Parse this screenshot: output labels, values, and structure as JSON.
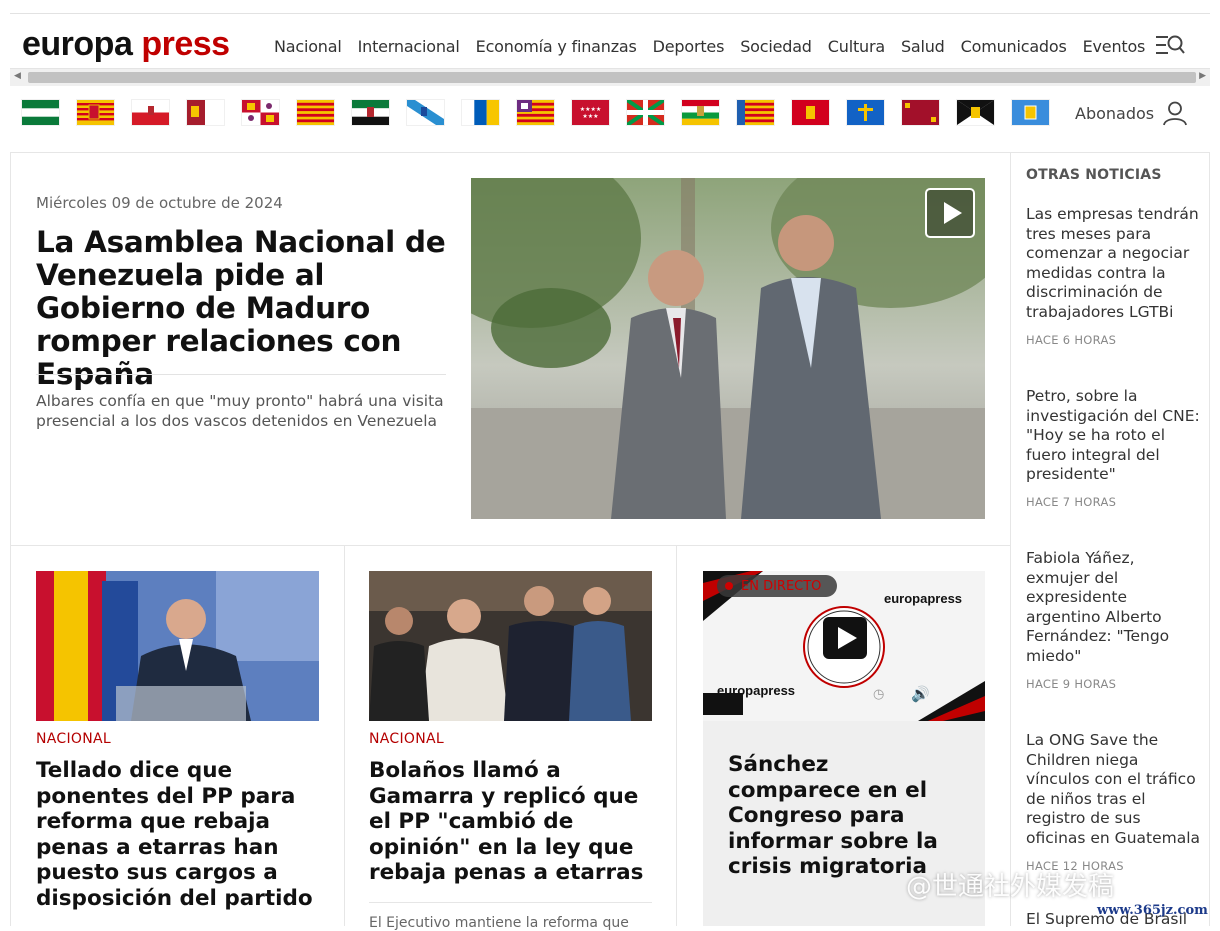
{
  "brand": {
    "part1": "europa",
    "part2": "press"
  },
  "nav": [
    "Nacional",
    "Internacional",
    "Economía y finanzas",
    "Deportes",
    "Sociedad",
    "Cultura",
    "Salud",
    "Comunicados",
    "Eventos"
  ],
  "account": {
    "label": "Abonados"
  },
  "lead_story": {
    "date": "Miércoles 09 de octubre de 2024",
    "title": "La Asamblea Nacional de Venezuela pide al Gobierno de Maduro romper relaciones con España",
    "summary": "Albares confía en que \"muy pronto\" habrá una visita presencial a los dos vascos detenidos en Venezuela"
  },
  "sidebar": {
    "title": "OTRAS NOTICIAS",
    "items": [
      {
        "text": "Las empresas tendrán tres meses para comenzar a negociar medidas contra la discriminación de trabajadores LGTBi",
        "time": "HACE 6 HORAS"
      },
      {
        "text": "Petro, sobre la investigación del CNE: \"Hoy se ha roto el fuero integral del presidente\"",
        "time": "HACE 7 HORAS"
      },
      {
        "text": "Fabiola Yáñez, exmujer del expresidente argentino Alberto Fernández: \"Tengo miedo\"",
        "time": "HACE 9 HORAS"
      },
      {
        "text": "La ONG Save the Children niega vínculos con el tráfico de niños tras el registro de sus oficinas en Guatemala",
        "time": "HACE 12 HORAS"
      },
      {
        "text": "El Supremo de Brasil",
        "time": ""
      }
    ]
  },
  "cards": [
    {
      "category": "NACIONAL",
      "title": "Tellado dice que ponentes del PP para reforma que rebaja penas a etarras han puesto sus cargos a disposición del partido"
    },
    {
      "category": "NACIONAL",
      "title": "Bolaños llamó a Gamarra y replicó que el PP \"cambió de opinión\" en la ley que rebaja penas a etarras",
      "summary": "El Ejecutivo mantiene la reforma que"
    },
    {
      "live_badge": "EN DIRECTO",
      "video_brand": "europapress",
      "title": "Sánchez comparece en el Congreso para informar sobre la crisis migratoria"
    }
  ],
  "watermark": {
    "text": "@世通社外媒发稿",
    "url": "www.365jz.com"
  },
  "colors": {
    "brand_red": "#c00000",
    "category_red": "#b40000"
  }
}
